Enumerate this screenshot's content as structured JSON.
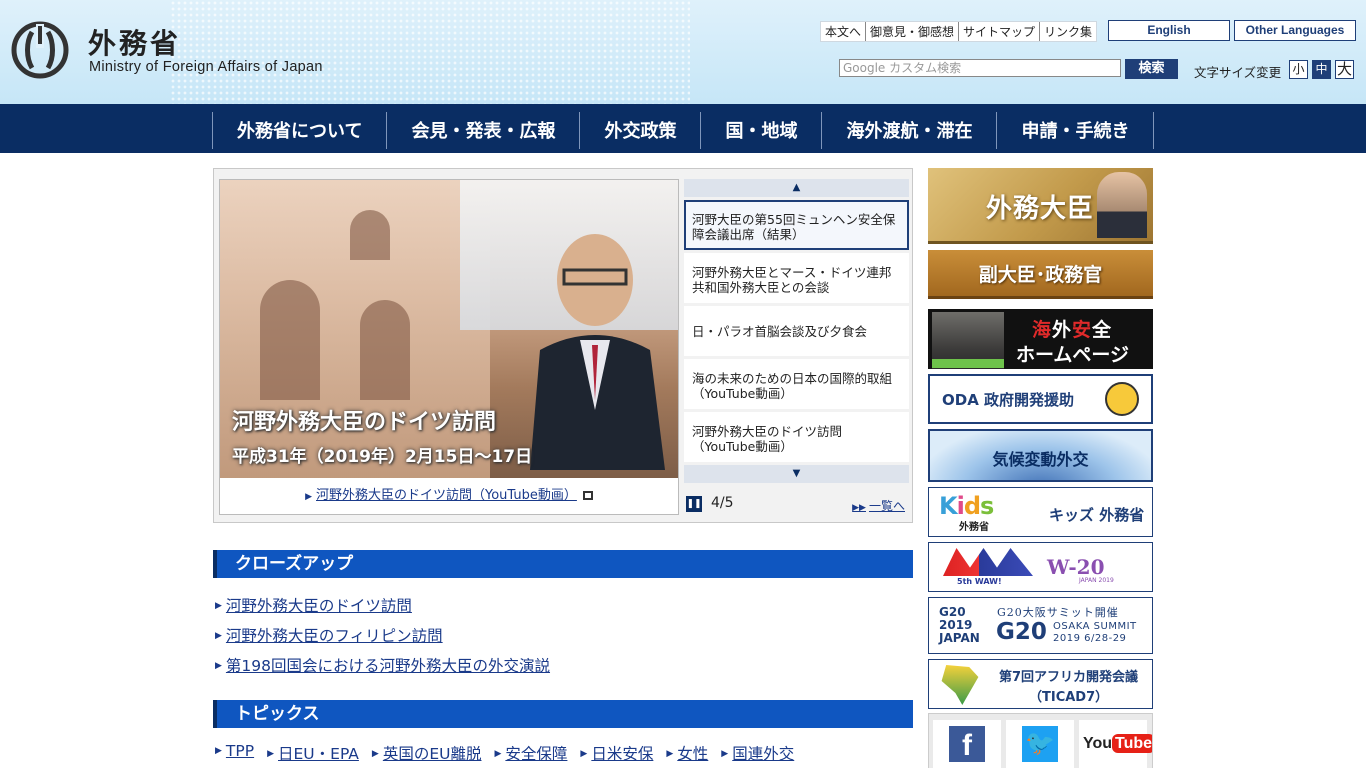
{
  "header": {
    "logo_jp": "外務省",
    "logo_en": "Ministry of Foreign Affairs of Japan",
    "utility_links": [
      "本文へ",
      "御意見・御感想",
      "サイトマップ",
      "リンク集"
    ],
    "english": "English",
    "other_languages": "Other Languages",
    "search_placeholder": "Google カスタム検索",
    "search_button": "検索",
    "font_size_label": "文字サイズ変更",
    "font_sizes": [
      "小",
      "中",
      "大"
    ]
  },
  "nav": [
    "外務省について",
    "会見・発表・広報",
    "外交政策",
    "国・地域",
    "海外渡航・滞在",
    "申請・手続き"
  ],
  "feature": {
    "slide_title": "河野外務大臣のドイツ訪問",
    "slide_date": "平成31年（2019年）2月15日～17日",
    "slide_caption": "河野外務大臣のドイツ訪問（YouTube動画）",
    "items": [
      "河野大臣の第55回ミュンヘン安全保障会議出席（結果）",
      "河野外務大臣とマース・ドイツ連邦共和国外務大臣との会談",
      "日・パラオ首脳会談及び夕食会",
      "海の未来のための日本の国際的取組（YouTube動画）",
      "河野外務大臣のドイツ訪問（YouTube動画）"
    ],
    "up_icon": "chevron-up",
    "down_icon": "chevron-down",
    "counter": "4/5",
    "list_link": "一覧へ"
  },
  "closeup": {
    "title": "クローズアップ",
    "items": [
      "河野外務大臣のドイツ訪問",
      "河野外務大臣のフィリピン訪問",
      "第198回国会における河野外務大臣の外交演説"
    ]
  },
  "topics": {
    "title": "トピックス",
    "items": [
      "TPP",
      "日EU・EPA",
      "英国のEU離脱",
      "安全保障",
      "日米安保",
      "女性",
      "国連外交"
    ]
  },
  "sidebar": {
    "minister": "外務大臣",
    "vice": "副大臣･政務官",
    "safety_1a": "海",
    "safety_1b": "外",
    "safety_1c": "安",
    "safety_1d": "全",
    "safety_2": "ホームページ",
    "oda": "ODA 政府開発援助",
    "climate": "気候変動外交",
    "kids_sub": "外務省",
    "kids_text": "キッズ 外務省",
    "waw_left": "5th WAW!",
    "waw_right": "W-20",
    "waw_right_sub": "JAPAN 2019",
    "g20_l1": "G20 2019 JAPAN",
    "g20_top": "G20大阪サミット開催",
    "g20_big": "G20",
    "g20_osaka": "OSAKA SUMMIT 2019 6/28-29",
    "ticad_1": "第7回アフリカ開発会議",
    "ticad_2": "（TICAD7）"
  },
  "colors": {
    "nav_bg": "#0a2d63",
    "section_head": "#0f56c0",
    "link": "#1a3a8a"
  }
}
